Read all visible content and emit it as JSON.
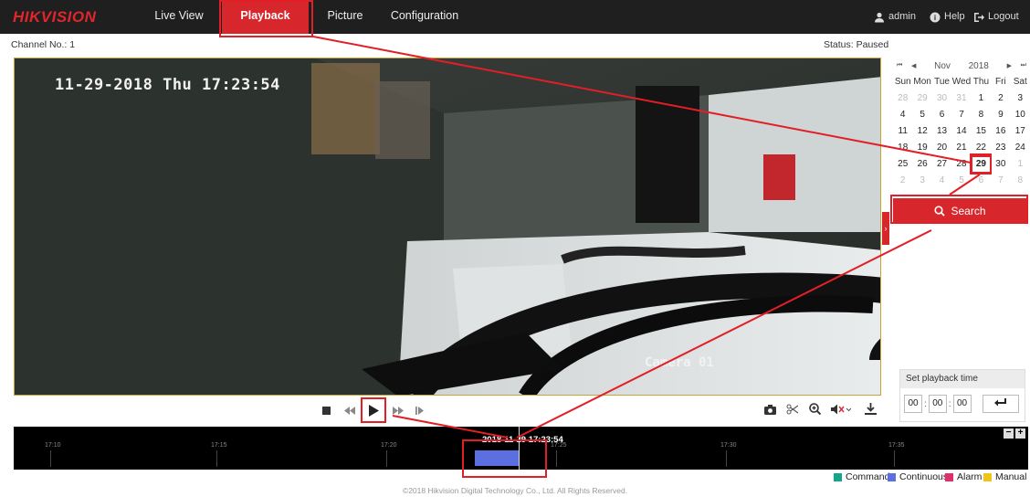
{
  "header": {
    "logo": "HIKVISION",
    "tabs": [
      {
        "label": "Live View"
      },
      {
        "label": "Playback"
      },
      {
        "label": "Picture"
      },
      {
        "label": "Configuration"
      }
    ],
    "user": "admin",
    "help": "Help",
    "logout": "Logout"
  },
  "status": {
    "channel": "Channel No.: 1",
    "state": "Status: Paused"
  },
  "video": {
    "osd_time": "11-29-2018 Thu 17:23:54",
    "osd_camera": "Camera 01"
  },
  "calendar": {
    "prev_year": "⏮",
    "prev_month": "◀",
    "month": "Nov",
    "year": "2018",
    "next_month": "▶",
    "next_year": "⏭",
    "weekdays": [
      "Sun",
      "Mon",
      "Tue",
      "Wed",
      "Thu",
      "Fri",
      "Sat"
    ],
    "days": [
      [
        "28",
        "29",
        "30",
        "31",
        "1",
        "2",
        "3"
      ],
      [
        "4",
        "5",
        "6",
        "7",
        "8",
        "9",
        "10"
      ],
      [
        "11",
        "12",
        "13",
        "14",
        "15",
        "16",
        "17"
      ],
      [
        "18",
        "19",
        "20",
        "21",
        "22",
        "23",
        "24"
      ],
      [
        "25",
        "26",
        "27",
        "28",
        "29",
        "30",
        "1"
      ],
      [
        "2",
        "3",
        "4",
        "5",
        "6",
        "7",
        "8"
      ]
    ],
    "selected": "29"
  },
  "search_button": "Search",
  "playback_time": {
    "title": "Set playback time",
    "hh": "00",
    "mm": "00",
    "ss": "00"
  },
  "timeline": {
    "ticks": [
      "17:10",
      "17:15",
      "17:20",
      "17:25",
      "17:30",
      "17:35"
    ],
    "current": "2018-11-29 17:23:54"
  },
  "legend": [
    {
      "label": "Command",
      "color": "#17a589"
    },
    {
      "label": "Continuous",
      "color": "#5b6fe0"
    },
    {
      "label": "Alarm",
      "color": "#e0306b"
    },
    {
      "label": "Manual",
      "color": "#f0c419"
    }
  ],
  "footer": "©2018 Hikvision Digital Technology Co., Ltd. All Rights Reserved.",
  "colors": {
    "accent": "#d7262c",
    "annotation": "#e21f26"
  }
}
